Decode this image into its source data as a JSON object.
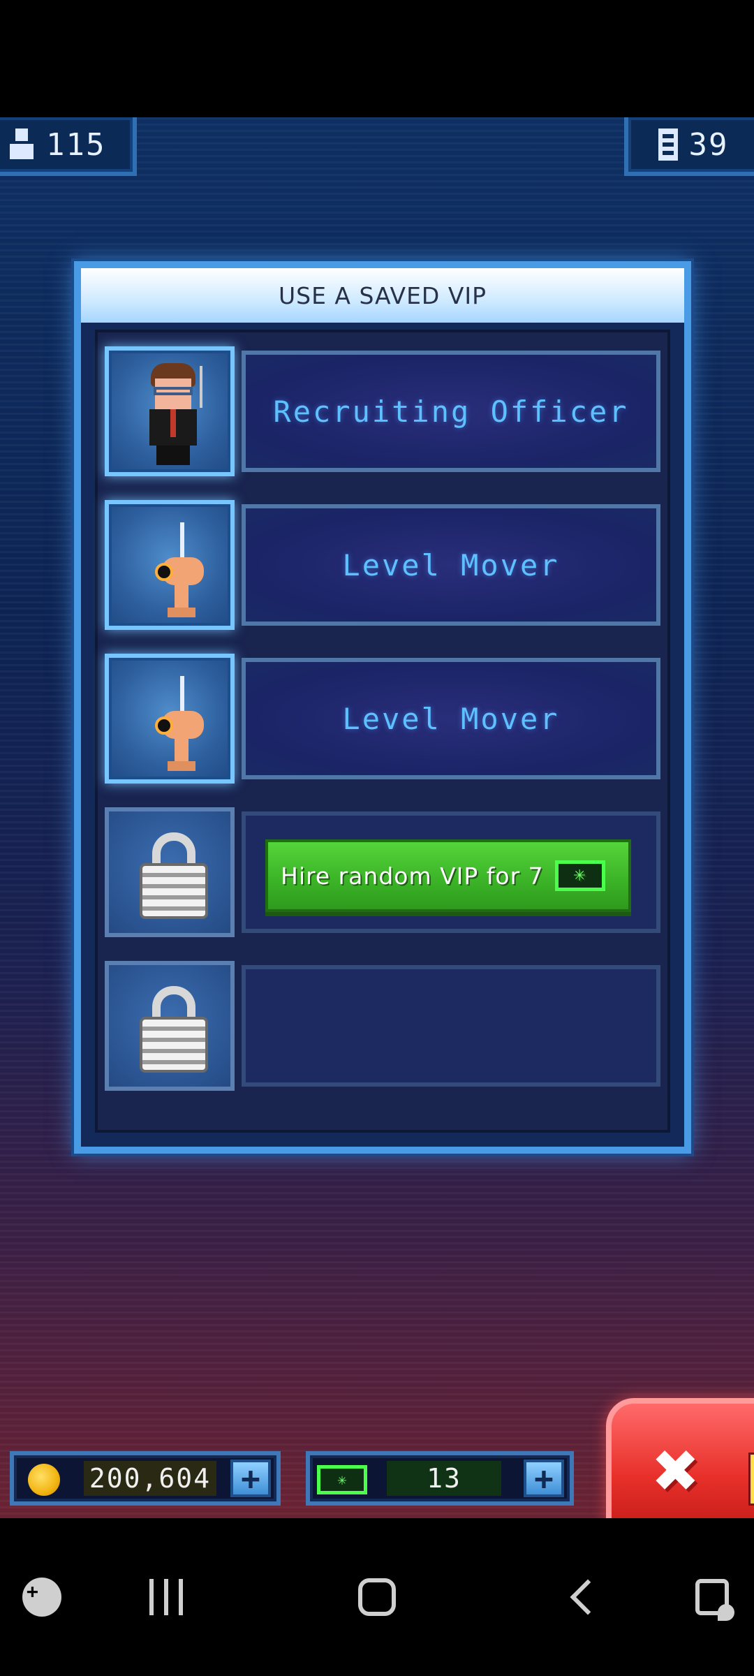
{
  "hud": {
    "population": "115",
    "floors": "39"
  },
  "dialog": {
    "title": "USE A SAVED VIP",
    "slots": [
      {
        "name": "Recruiting Officer",
        "portrait": "recruiting-officer"
      },
      {
        "name": "Level Mover",
        "portrait": "level-mover"
      },
      {
        "name": "Level Mover",
        "portrait": "level-mover"
      }
    ],
    "hire_button_label": "Hire random VIP for 7"
  },
  "currency": {
    "coins": "200,604",
    "bux": "13"
  },
  "icons": {
    "population": "person-icon",
    "floors": "building-icon",
    "coins": "coin-icon",
    "bux": "bux-icon",
    "lock": "lock-icon",
    "close": "close-icon"
  },
  "colors": {
    "accent_blue": "#4a9be6",
    "name_text": "#5ec0ff",
    "hire_green": "#3cb528",
    "close_red": "#e8302a"
  }
}
